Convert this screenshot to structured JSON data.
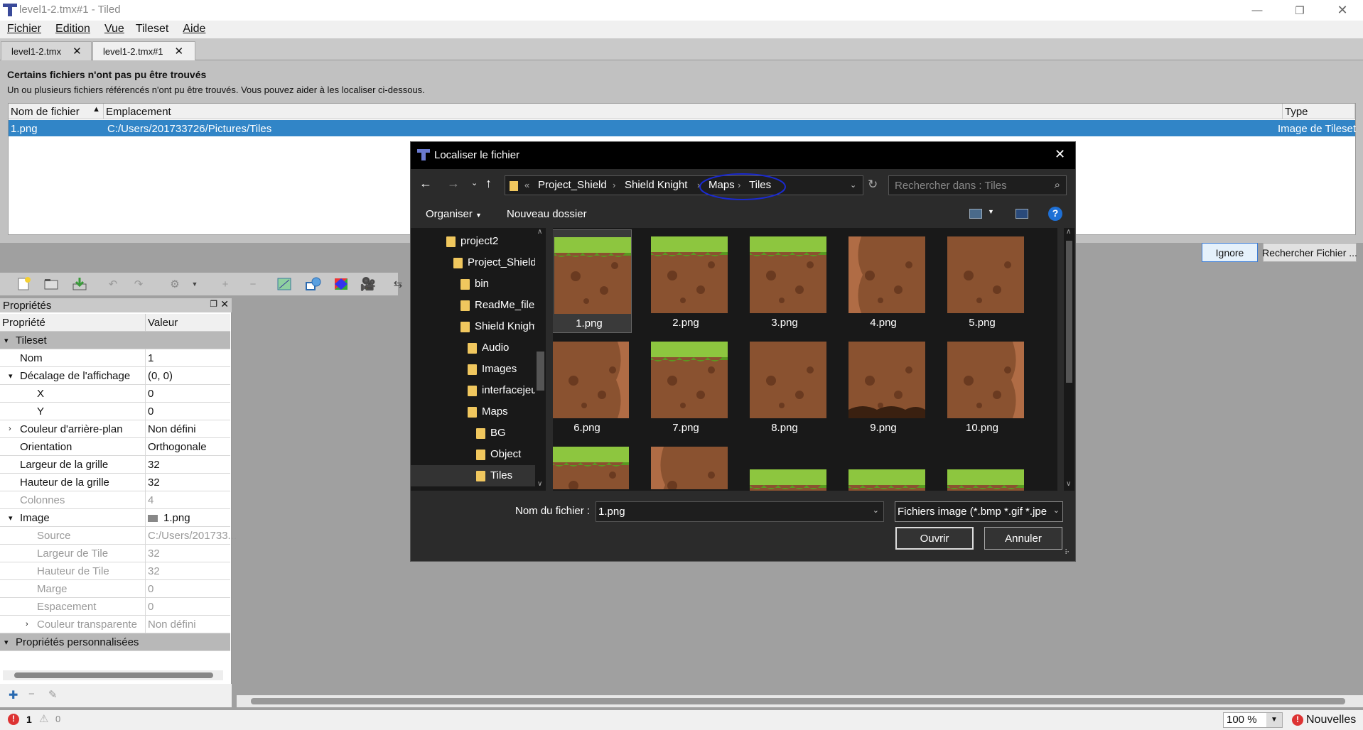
{
  "window": {
    "title": "level1-2.tmx#1 - Tiled",
    "min_icon": "minimize-icon",
    "max_icon": "restore-icon",
    "close_icon": "close-icon"
  },
  "menu": [
    "Fichier",
    "Edition",
    "Vue",
    "Tileset",
    "Aide"
  ],
  "tabs": [
    {
      "label": "level1-2.tmx",
      "close": "✕"
    },
    {
      "label": "level1-2.tmx#1",
      "close": "✕"
    }
  ],
  "missing": {
    "title": "Certains fichiers n'ont pas pu être trouvés",
    "text": "Un ou plusieurs fichiers référencés n'ont pu être trouvés. Vous pouvez aider à les localiser ci-dessous.",
    "columns": [
      "Nom de fichier",
      "Emplacement",
      "Type"
    ],
    "row": {
      "name": "1.png",
      "location": "C:/Users/201733726/Pictures/Tiles",
      "type": "Image de Tileset"
    },
    "ignore_btn": "Ignore",
    "search_btn": "Rechercher Fichier ..."
  },
  "properties": {
    "title": "Propriétés",
    "col_prop": "Propriété",
    "col_val": "Valeur",
    "rows": [
      {
        "k": "Tileset",
        "v": "",
        "group": true
      },
      {
        "k": "Nom",
        "v": "1"
      },
      {
        "k": "Décalage de l'affichage",
        "v": "(0, 0)",
        "exp": "▾"
      },
      {
        "k": "X",
        "v": "0"
      },
      {
        "k": "Y",
        "v": "0"
      },
      {
        "k": "Couleur d'arrière-plan",
        "v": "Non défini",
        "exp": "›"
      },
      {
        "k": "Orientation",
        "v": "Orthogonale"
      },
      {
        "k": "Largeur de la grille",
        "v": "32"
      },
      {
        "k": "Hauteur de la grille",
        "v": "32"
      },
      {
        "k": "Colonnes",
        "v": "4",
        "dim": true
      },
      {
        "k": "Image",
        "v": "1.png",
        "exp": "▾"
      },
      {
        "k": "Source",
        "v": "C:/Users/201733...",
        "dim": true
      },
      {
        "k": "Largeur de Tile",
        "v": "32",
        "dim": true
      },
      {
        "k": "Hauteur de Tile",
        "v": "32",
        "dim": true
      },
      {
        "k": "Marge",
        "v": "0",
        "dim": true
      },
      {
        "k": "Espacement",
        "v": "0",
        "dim": true
      },
      {
        "k": "Couleur transparente",
        "v": "Non défini",
        "dim": true,
        "exp": "›"
      },
      {
        "k": "Propriétés personnalisées",
        "v": "",
        "group": true
      }
    ]
  },
  "status": {
    "errors": "1",
    "warnings": "0",
    "zoom": "100 %",
    "news": "Nouvelles"
  },
  "dialog": {
    "title": "Localiser le fichier",
    "breadcrumb": [
      "Project_Shield",
      "Shield Knight",
      "Maps",
      "Tiles"
    ],
    "search_placeholder": "Rechercher dans : Tiles",
    "organize": "Organiser",
    "new_folder": "Nouveau dossier",
    "nav": [
      {
        "label": "project2",
        "indent": 0
      },
      {
        "label": "Project_Shield",
        "indent": 1
      },
      {
        "label": "bin",
        "indent": 2
      },
      {
        "label": "ReadMe_files",
        "indent": 2
      },
      {
        "label": "Shield Knight",
        "indent": 2
      },
      {
        "label": "Audio",
        "indent": 3
      },
      {
        "label": "Images",
        "indent": 3
      },
      {
        "label": "interfacejeu",
        "indent": 3
      },
      {
        "label": "Maps",
        "indent": 3
      },
      {
        "label": "BG",
        "indent": 4
      },
      {
        "label": "Object",
        "indent": 4
      },
      {
        "label": "Tiles",
        "indent": 4,
        "selected": true
      }
    ],
    "files": [
      "1.png",
      "2.png",
      "3.png",
      "4.png",
      "5.png",
      "6.png",
      "7.png",
      "8.png",
      "9.png",
      "10.png"
    ],
    "filename_label": "Nom du fichier :",
    "filename_value": "1.png",
    "filter": "Fichiers image (*.bmp *.gif *.jpe",
    "open_btn": "Ouvrir",
    "cancel_btn": "Annuler"
  }
}
